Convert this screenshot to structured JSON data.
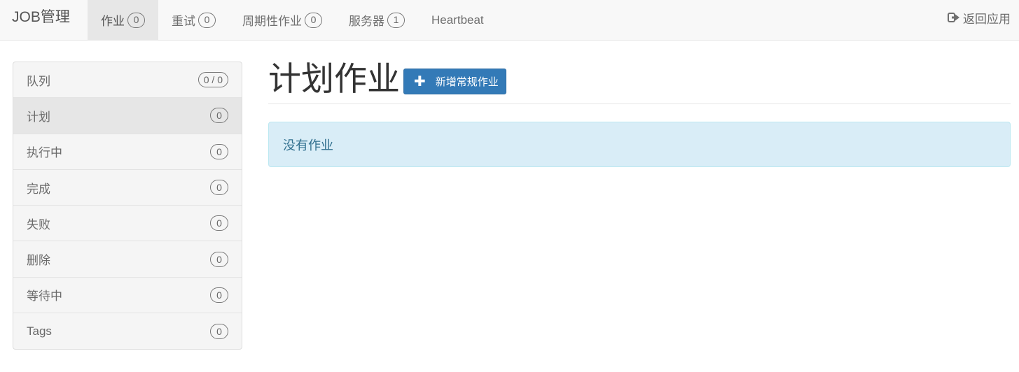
{
  "navbar": {
    "brand": "JOB管理",
    "tabs": [
      {
        "label": "作业",
        "count": "0"
      },
      {
        "label": "重试",
        "count": "0"
      },
      {
        "label": "周期性作业",
        "count": "0"
      },
      {
        "label": "服务器",
        "count": "1"
      },
      {
        "label": "Heartbeat"
      }
    ],
    "back_label": "返回应用",
    "back_icon": "sign-out-icon"
  },
  "sidebar": {
    "items": [
      {
        "label": "队列",
        "count": "0 / 0"
      },
      {
        "label": "计划",
        "count": "0"
      },
      {
        "label": "执行中",
        "count": "0"
      },
      {
        "label": "完成",
        "count": "0"
      },
      {
        "label": "失败",
        "count": "0"
      },
      {
        "label": "删除",
        "count": "0"
      },
      {
        "label": "等待中",
        "count": "0"
      },
      {
        "label": "Tags",
        "count": "0"
      }
    ]
  },
  "main": {
    "title": "计划作业",
    "add_button_label": "新增常规作业",
    "add_button_icon": "plus-icon",
    "empty_message": "没有作业"
  },
  "colors": {
    "primary": "#337ab7",
    "info_bg": "#d9edf7",
    "info_text": "#31708f"
  }
}
